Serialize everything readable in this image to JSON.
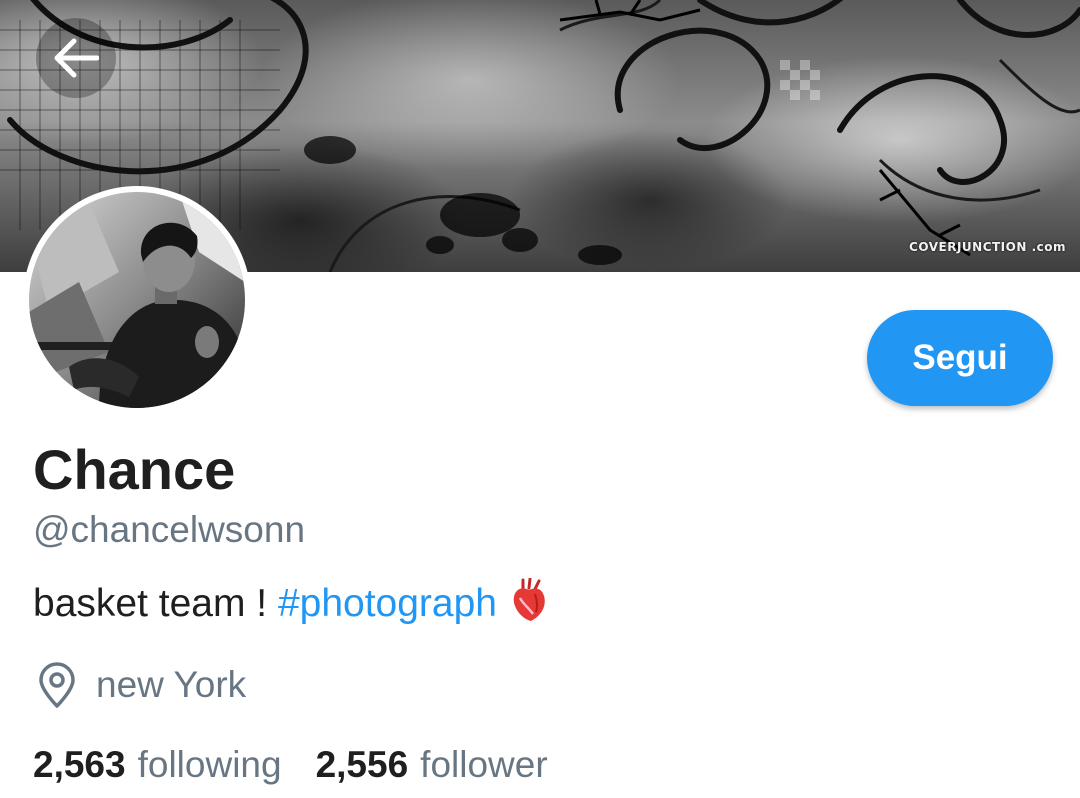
{
  "header": {
    "banner_watermark": "COVERJUNCTION .com",
    "back_icon": "arrow-left-icon"
  },
  "profile": {
    "display_name": "Chance",
    "handle": "@chancelwsonn",
    "bio_text": "basket team ! ",
    "bio_hashtag": "#photograph",
    "bio_emoji_icon": "anatomical-heart-icon",
    "location_icon": "location-pin-icon",
    "location": "new York",
    "following_count": "2,563",
    "following_label": "following",
    "follower_count": "2,556",
    "follower_label": "follower"
  },
  "actions": {
    "follow_label": "Segui"
  },
  "colors": {
    "accent": "#2196f3",
    "text_primary": "#1f1f1f",
    "text_secondary": "#687684"
  }
}
